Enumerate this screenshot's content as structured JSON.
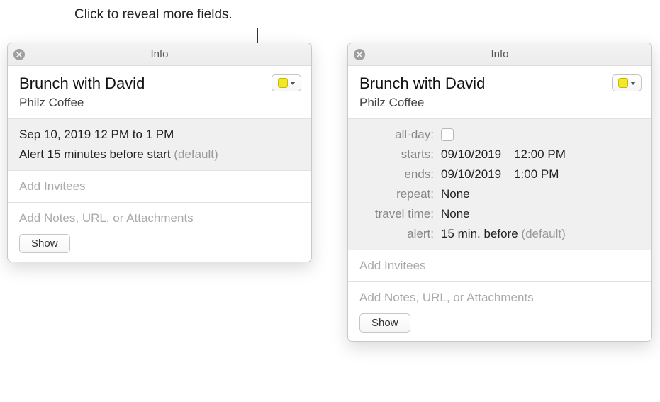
{
  "callout": "Click to reveal more fields.",
  "left": {
    "window_title": "Info",
    "event_title": "Brunch with David",
    "event_location": "Philz Coffee",
    "datetime": "Sep 10, 2019  12 PM to 1 PM",
    "alert_text": "Alert 15 minutes before start ",
    "alert_default": "(default)",
    "invitees_placeholder": "Add Invitees",
    "notes_placeholder": "Add Notes, URL, or Attachments",
    "show_label": "Show",
    "calendar_color": "#f4e726"
  },
  "right": {
    "window_title": "Info",
    "event_title": "Brunch with David",
    "event_location": "Philz Coffee",
    "calendar_color": "#f4e726",
    "fields": {
      "allday_label": "all-day:",
      "allday_checked": false,
      "starts_label": "starts:",
      "starts_date": "09/10/2019",
      "starts_time": "12:00 PM",
      "ends_label": "ends:",
      "ends_date": "09/10/2019",
      "ends_time": "1:00 PM",
      "repeat_label": "repeat:",
      "repeat_value": "None",
      "travel_label": "travel time:",
      "travel_value": "None",
      "alert_label": "alert:",
      "alert_value": "15 min. before ",
      "alert_default": "(default)"
    },
    "invitees_placeholder": "Add Invitees",
    "notes_placeholder": "Add Notes, URL, or Attachments",
    "show_label": "Show"
  }
}
